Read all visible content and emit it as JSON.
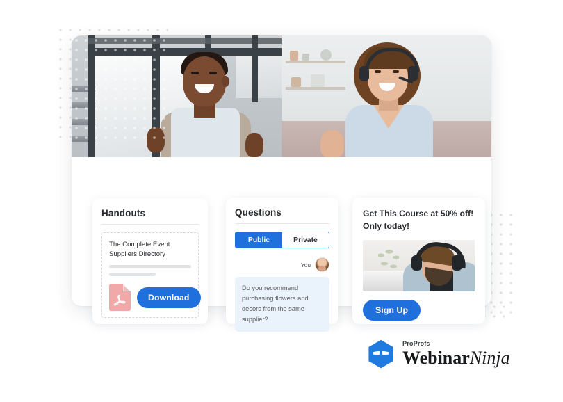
{
  "brand": {
    "accent_blue": "#1f6fdc",
    "logo_hex_blue": "#1f7be0",
    "pdf_icon_pink": "#f0a8a8",
    "company": "ProProfs",
    "product_bold": "Webinar",
    "product_italic": "Ninja",
    "logo_mark_name": "ninja-hexagon-icon"
  },
  "video": {
    "left_tile_label": "presenter-video-left",
    "right_tile_label": "presenter-video-right"
  },
  "handouts": {
    "title": "Handouts",
    "item": {
      "name": "The Complete Event Suppliers Directory",
      "file_type_icon": "pdf-file-icon",
      "download_label": "Download"
    }
  },
  "questions": {
    "title": "Questions",
    "tabs": [
      {
        "label": "Public",
        "active": true
      },
      {
        "label": "Private",
        "active": false
      }
    ],
    "message": {
      "author": "You",
      "avatar": "user-avatar",
      "text": "Do you recommend purchasing flowers and decors from the same supplier?"
    }
  },
  "promo": {
    "title": "Get This Course at 50% off! Only today!",
    "image_alt": "man-with-headphones-at-laptop",
    "cta_label": "Sign Up"
  }
}
